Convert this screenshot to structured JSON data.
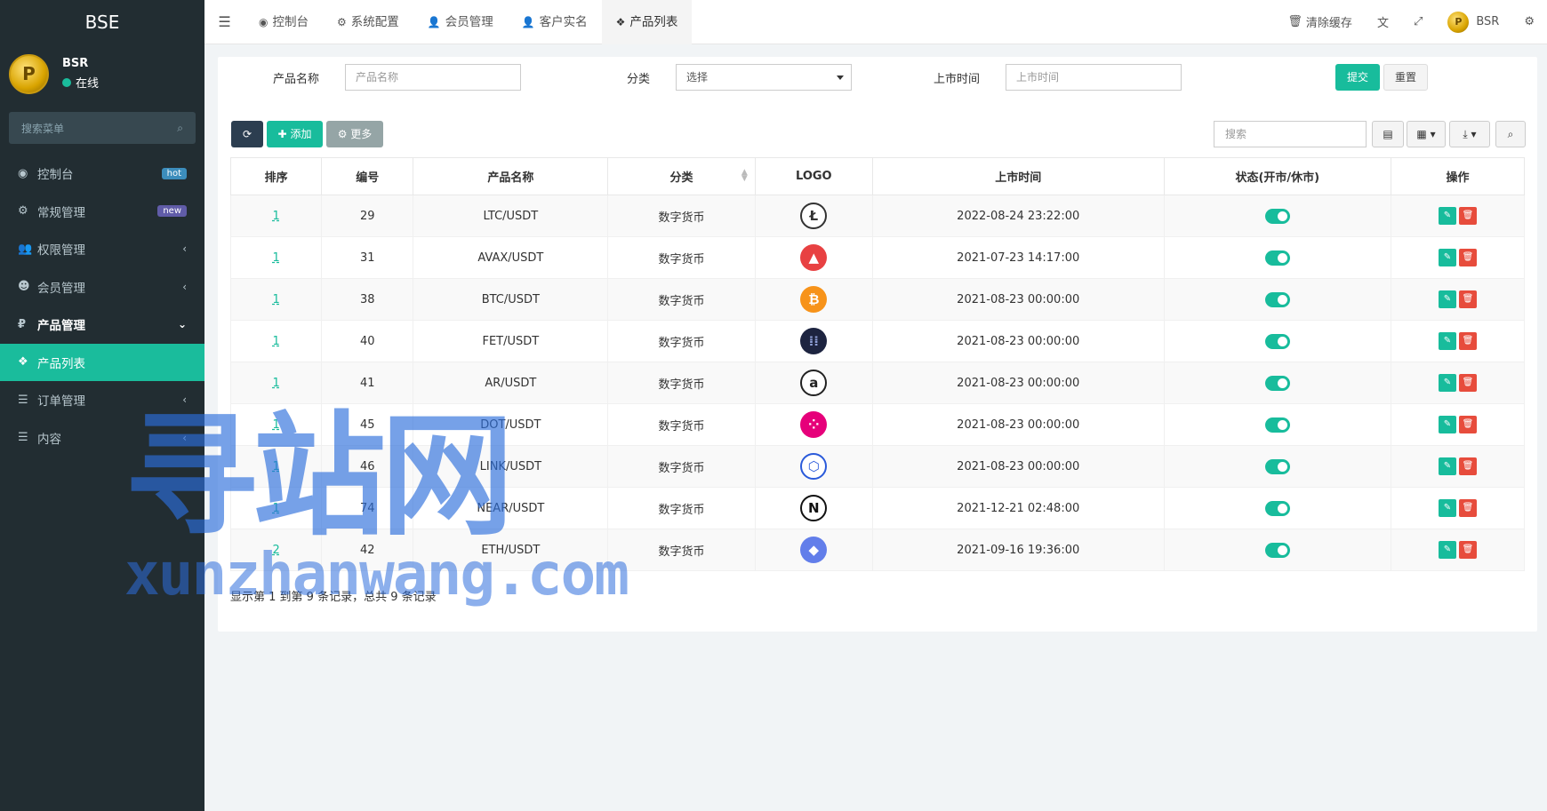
{
  "sidebar": {
    "brand": "BSE",
    "user": {
      "name": "BSR",
      "status": "在线",
      "avatar_letter": "P"
    },
    "search_placeholder": "搜索菜单",
    "items": [
      {
        "label": "控制台",
        "icon": "dashboard-icon",
        "glyph": "◉",
        "badge": "hot"
      },
      {
        "label": "常规管理",
        "icon": "cogs-icon",
        "glyph": "⚙",
        "badge": "new"
      },
      {
        "label": "权限管理",
        "icon": "group-icon",
        "glyph": "👥",
        "arrow": "‹"
      },
      {
        "label": "会员管理",
        "icon": "user-circle-icon",
        "glyph": "☻",
        "arrow": "‹"
      },
      {
        "label": "产品管理",
        "icon": "rub-icon",
        "glyph": "₽",
        "arrow": "⌄"
      },
      {
        "label": "产品列表",
        "icon": "cubes-icon",
        "glyph": "❖"
      },
      {
        "label": "订单管理",
        "icon": "list-icon",
        "glyph": "☰",
        "arrow": "‹"
      },
      {
        "label": "内容",
        "icon": "list-icon",
        "glyph": "☰",
        "arrow": "‹"
      }
    ]
  },
  "topbar": {
    "tabs": [
      {
        "label": "控制台",
        "icon": "dashboard-icon",
        "glyph": "◉"
      },
      {
        "label": "系统配置",
        "icon": "gear-icon",
        "glyph": "⚙"
      },
      {
        "label": "会员管理",
        "icon": "user-icon",
        "glyph": "👤"
      },
      {
        "label": "客户实名",
        "icon": "user-icon",
        "glyph": "👤"
      },
      {
        "label": "产品列表",
        "icon": "cubes-icon",
        "glyph": "❖"
      }
    ],
    "clear_cache": "清除缓存",
    "user_name": "BSR"
  },
  "filter": {
    "name_label": "产品名称",
    "name_placeholder": "产品名称",
    "category_label": "分类",
    "category_value": "选择",
    "time_label": "上市时间",
    "time_placeholder": "上市时间",
    "submit": "提交",
    "reset": "重置"
  },
  "toolbar": {
    "add": "添加",
    "more": "更多",
    "search_placeholder": "搜索"
  },
  "table": {
    "headers": [
      "排序",
      "编号",
      "产品名称",
      "分类",
      "LOGO",
      "上市时间",
      "状态(开市/休市)",
      "操作"
    ],
    "rows": [
      {
        "sort": "1",
        "id": "29",
        "name": "LTC/USDT",
        "category": "数字货币",
        "logo": "litecoin-logo",
        "glyph": "Ł",
        "logo_bg": "#ffffff",
        "logo_fg": "#333333",
        "time": "2022-08-24 23:22:00"
      },
      {
        "sort": "1",
        "id": "31",
        "name": "AVAX/USDT",
        "category": "数字货币",
        "logo": "avalanche-logo",
        "glyph": "▲",
        "logo_bg": "#e84142",
        "logo_fg": "#ffffff",
        "time": "2021-07-23 14:17:00"
      },
      {
        "sort": "1",
        "id": "38",
        "name": "BTC/USDT",
        "category": "数字货币",
        "logo": "bitcoin-logo",
        "glyph": "₿",
        "logo_bg": "#f7931a",
        "logo_fg": "#ffffff",
        "time": "2021-08-23 00:00:00"
      },
      {
        "sort": "1",
        "id": "40",
        "name": "FET/USDT",
        "category": "数字货币",
        "logo": "fetch-ai-logo",
        "glyph": "⁞⁞",
        "logo_bg": "#1d2440",
        "logo_fg": "#8fa0d8",
        "time": "2021-08-23 00:00:00"
      },
      {
        "sort": "1",
        "id": "41",
        "name": "AR/USDT",
        "category": "数字货币",
        "logo": "arweave-logo",
        "glyph": "a",
        "logo_bg": "#ffffff",
        "logo_fg": "#222222",
        "time": "2021-08-23 00:00:00"
      },
      {
        "sort": "1",
        "id": "45",
        "name": "DOT/USDT",
        "category": "数字货币",
        "logo": "polkadot-logo",
        "glyph": "⁘",
        "logo_bg": "#e6007a",
        "logo_fg": "#ffffff",
        "time": "2021-08-23 00:00:00"
      },
      {
        "sort": "1",
        "id": "46",
        "name": "LINK/USDT",
        "category": "数字货币",
        "logo": "chainlink-logo",
        "glyph": "⬡",
        "logo_bg": "#ffffff",
        "logo_fg": "#2a5ada",
        "time": "2021-08-23 00:00:00"
      },
      {
        "sort": "1",
        "id": "74",
        "name": "NEAR/USDT",
        "category": "数字货币",
        "logo": "near-logo",
        "glyph": "N",
        "logo_bg": "#ffffff",
        "logo_fg": "#111111",
        "time": "2021-12-21 02:48:00"
      },
      {
        "sort": "2",
        "id": "42",
        "name": "ETH/USDT",
        "category": "数字货币",
        "logo": "ethereum-logo",
        "glyph": "◆",
        "logo_bg": "#627eea",
        "logo_fg": "#ffffff",
        "time": "2021-09-16 19:36:00"
      }
    ]
  },
  "pagination_info": "显示第 1 到第 9 条记录，总共 9 条记录",
  "watermark": {
    "line1": "寻站网",
    "line2": "xunzhanwang.com"
  },
  "colors": {
    "accent": "#18bc9c",
    "sidebar_bg": "#222d32",
    "danger": "#e74c3c"
  }
}
